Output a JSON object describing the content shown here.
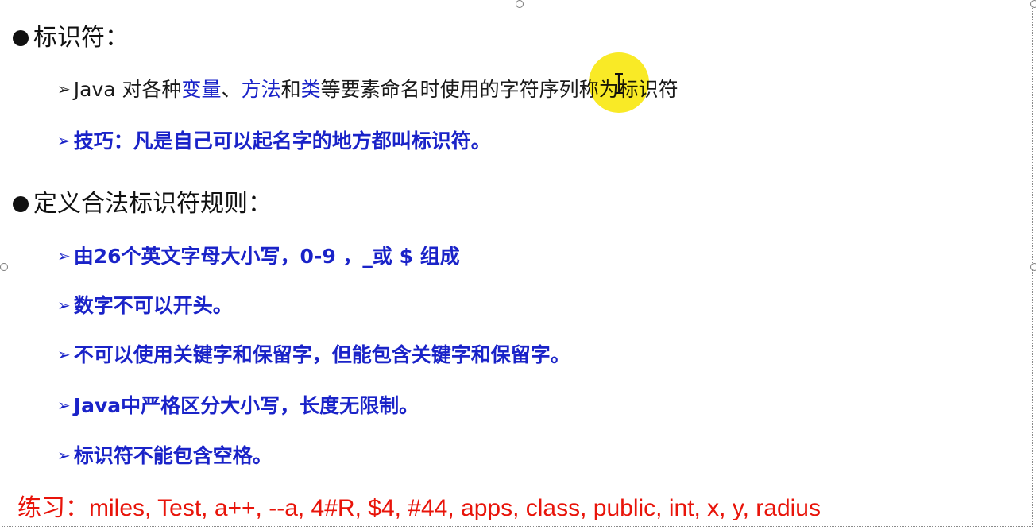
{
  "heading1": {
    "text": "标识符："
  },
  "item1": {
    "prefix": "Java 对各种",
    "variable": "变量",
    "sep1": "、",
    "method": "方法",
    "and": "和",
    "klass": "类",
    "suffix": "等要素命名时使用的字符序列称为标识符"
  },
  "item2": {
    "text": "技巧：凡是自己可以起名字的地方都叫标识符。"
  },
  "heading2": {
    "text": "定义合法标识符规则："
  },
  "rules": [
    "由26个英文字母大小写，0-9 ，_或 $ 组成",
    "数字不可以开头。",
    "不可以使用关键字和保留字，但能包含关键字和保留字。",
    "Java中严格区分大小写，长度无限制。",
    "标识符不能包含空格。"
  ],
  "practice": {
    "label": "练习：",
    "examples": "miles, Test, a++, --a, 4#R, $4, #44, apps, class, public, int, x, y, radius"
  },
  "colors": {
    "text": "#1a1a1a",
    "blue": "#1a23c8",
    "red": "#e8140a",
    "highlight": "#f8e600"
  },
  "icons": {
    "bullet": "filled-circle-icon",
    "sub_bullet": "arrow-bullet-icon",
    "cursor": "text-cursor-icon"
  }
}
